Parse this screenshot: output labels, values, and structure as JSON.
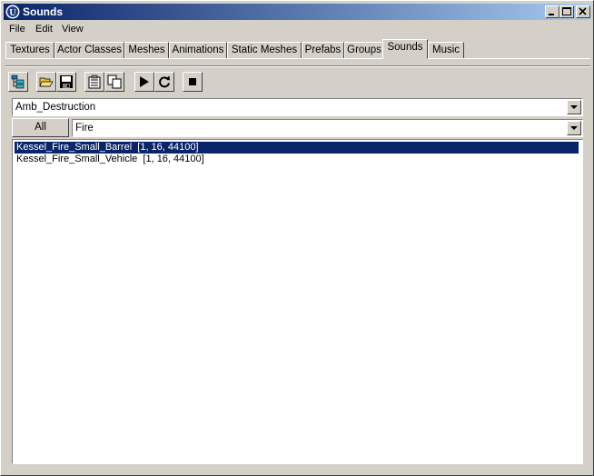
{
  "window": {
    "title": "Sounds"
  },
  "menu": [
    "File",
    "Edit",
    "View"
  ],
  "tabs": [
    "Textures",
    "Actor Classes",
    "Meshes",
    "Animations",
    "Static Meshes",
    "Prefabs",
    "Groups",
    "Sounds",
    "Music"
  ],
  "active_tab": "Sounds",
  "toolbar": [
    "tree-view-icon",
    "open-folder-icon",
    "save-icon",
    "properties-icon",
    "copy-icon",
    "play-icon",
    "loop-icon",
    "stop-icon"
  ],
  "package_select": {
    "value": "Amb_Destruction"
  },
  "all_button": {
    "label": "All"
  },
  "group_select": {
    "value": "Fire"
  },
  "sounds": [
    {
      "name": "Kessel_Fire_Small_Barrel  [1, 16, 44100]",
      "selected": true
    },
    {
      "name": "Kessel_Fire_Small_Vehicle  [1, 16, 44100]",
      "selected": false
    }
  ],
  "colors": {
    "selection": "#0a246a",
    "titlebar": "#0a246a"
  }
}
